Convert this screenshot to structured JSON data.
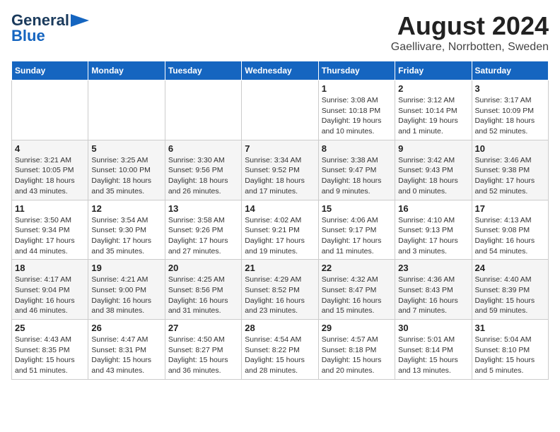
{
  "logo": {
    "line1": "General",
    "line2": "Blue"
  },
  "title": "August 2024",
  "subtitle": "Gaellivare, Norrbotten, Sweden",
  "weekdays": [
    "Sunday",
    "Monday",
    "Tuesday",
    "Wednesday",
    "Thursday",
    "Friday",
    "Saturday"
  ],
  "weeks": [
    [
      {
        "day": "",
        "info": ""
      },
      {
        "day": "",
        "info": ""
      },
      {
        "day": "",
        "info": ""
      },
      {
        "day": "",
        "info": ""
      },
      {
        "day": "1",
        "info": "Sunrise: 3:08 AM\nSunset: 10:18 PM\nDaylight: 19 hours\nand 10 minutes."
      },
      {
        "day": "2",
        "info": "Sunrise: 3:12 AM\nSunset: 10:14 PM\nDaylight: 19 hours\nand 1 minute."
      },
      {
        "day": "3",
        "info": "Sunrise: 3:17 AM\nSunset: 10:09 PM\nDaylight: 18 hours\nand 52 minutes."
      }
    ],
    [
      {
        "day": "4",
        "info": "Sunrise: 3:21 AM\nSunset: 10:05 PM\nDaylight: 18 hours\nand 43 minutes."
      },
      {
        "day": "5",
        "info": "Sunrise: 3:25 AM\nSunset: 10:00 PM\nDaylight: 18 hours\nand 35 minutes."
      },
      {
        "day": "6",
        "info": "Sunrise: 3:30 AM\nSunset: 9:56 PM\nDaylight: 18 hours\nand 26 minutes."
      },
      {
        "day": "7",
        "info": "Sunrise: 3:34 AM\nSunset: 9:52 PM\nDaylight: 18 hours\nand 17 minutes."
      },
      {
        "day": "8",
        "info": "Sunrise: 3:38 AM\nSunset: 9:47 PM\nDaylight: 18 hours\nand 9 minutes."
      },
      {
        "day": "9",
        "info": "Sunrise: 3:42 AM\nSunset: 9:43 PM\nDaylight: 18 hours\nand 0 minutes."
      },
      {
        "day": "10",
        "info": "Sunrise: 3:46 AM\nSunset: 9:38 PM\nDaylight: 17 hours\nand 52 minutes."
      }
    ],
    [
      {
        "day": "11",
        "info": "Sunrise: 3:50 AM\nSunset: 9:34 PM\nDaylight: 17 hours\nand 44 minutes."
      },
      {
        "day": "12",
        "info": "Sunrise: 3:54 AM\nSunset: 9:30 PM\nDaylight: 17 hours\nand 35 minutes."
      },
      {
        "day": "13",
        "info": "Sunrise: 3:58 AM\nSunset: 9:26 PM\nDaylight: 17 hours\nand 27 minutes."
      },
      {
        "day": "14",
        "info": "Sunrise: 4:02 AM\nSunset: 9:21 PM\nDaylight: 17 hours\nand 19 minutes."
      },
      {
        "day": "15",
        "info": "Sunrise: 4:06 AM\nSunset: 9:17 PM\nDaylight: 17 hours\nand 11 minutes."
      },
      {
        "day": "16",
        "info": "Sunrise: 4:10 AM\nSunset: 9:13 PM\nDaylight: 17 hours\nand 3 minutes."
      },
      {
        "day": "17",
        "info": "Sunrise: 4:13 AM\nSunset: 9:08 PM\nDaylight: 16 hours\nand 54 minutes."
      }
    ],
    [
      {
        "day": "18",
        "info": "Sunrise: 4:17 AM\nSunset: 9:04 PM\nDaylight: 16 hours\nand 46 minutes."
      },
      {
        "day": "19",
        "info": "Sunrise: 4:21 AM\nSunset: 9:00 PM\nDaylight: 16 hours\nand 38 minutes."
      },
      {
        "day": "20",
        "info": "Sunrise: 4:25 AM\nSunset: 8:56 PM\nDaylight: 16 hours\nand 31 minutes."
      },
      {
        "day": "21",
        "info": "Sunrise: 4:29 AM\nSunset: 8:52 PM\nDaylight: 16 hours\nand 23 minutes."
      },
      {
        "day": "22",
        "info": "Sunrise: 4:32 AM\nSunset: 8:47 PM\nDaylight: 16 hours\nand 15 minutes."
      },
      {
        "day": "23",
        "info": "Sunrise: 4:36 AM\nSunset: 8:43 PM\nDaylight: 16 hours\nand 7 minutes."
      },
      {
        "day": "24",
        "info": "Sunrise: 4:40 AM\nSunset: 8:39 PM\nDaylight: 15 hours\nand 59 minutes."
      }
    ],
    [
      {
        "day": "25",
        "info": "Sunrise: 4:43 AM\nSunset: 8:35 PM\nDaylight: 15 hours\nand 51 minutes."
      },
      {
        "day": "26",
        "info": "Sunrise: 4:47 AM\nSunset: 8:31 PM\nDaylight: 15 hours\nand 43 minutes."
      },
      {
        "day": "27",
        "info": "Sunrise: 4:50 AM\nSunset: 8:27 PM\nDaylight: 15 hours\nand 36 minutes."
      },
      {
        "day": "28",
        "info": "Sunrise: 4:54 AM\nSunset: 8:22 PM\nDaylight: 15 hours\nand 28 minutes."
      },
      {
        "day": "29",
        "info": "Sunrise: 4:57 AM\nSunset: 8:18 PM\nDaylight: 15 hours\nand 20 minutes."
      },
      {
        "day": "30",
        "info": "Sunrise: 5:01 AM\nSunset: 8:14 PM\nDaylight: 15 hours\nand 13 minutes."
      },
      {
        "day": "31",
        "info": "Sunrise: 5:04 AM\nSunset: 8:10 PM\nDaylight: 15 hours\nand 5 minutes."
      }
    ]
  ]
}
